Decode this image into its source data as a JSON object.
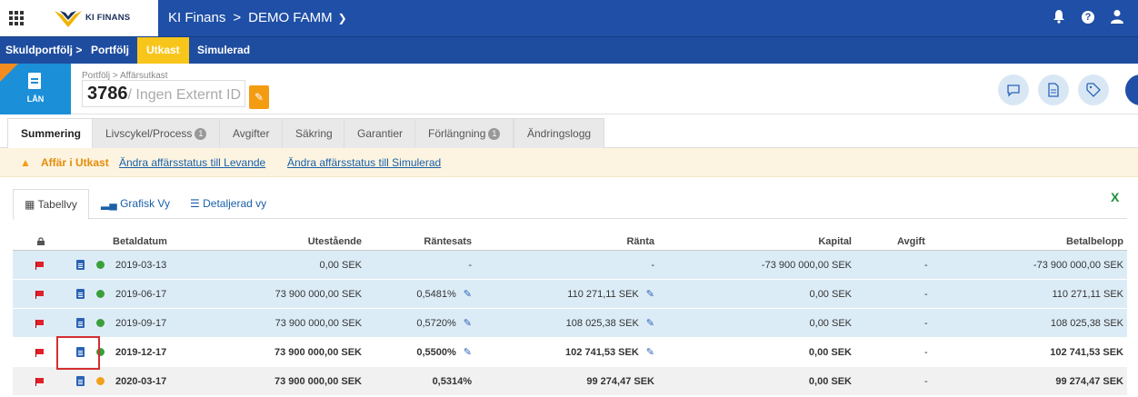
{
  "topbar": {
    "brand": "KI FINANS",
    "crumb_company": "KI Finans",
    "crumb_separator": ">",
    "crumb_client": "DEMO FAMM",
    "colors": {
      "primary": "#1f4fa6"
    }
  },
  "subnav": {
    "items": [
      {
        "label": "Skuldportfölj >"
      },
      {
        "label": "Portfölj"
      },
      {
        "label": "Utkast"
      },
      {
        "label": "Simulerad"
      }
    ],
    "active_color": "#f8c51a"
  },
  "header": {
    "type_label": "LÅN",
    "breadcrumb": "Portfölj > Affärsutkast",
    "id_number": "3786",
    "id_external": "/ Ingen Externt ID"
  },
  "tabs": [
    {
      "label": "Summering"
    },
    {
      "label": "Livscykel/Process",
      "badge": "1"
    },
    {
      "label": "Avgifter"
    },
    {
      "label": "Säkring"
    },
    {
      "label": "Garantier"
    },
    {
      "label": "Förlängning",
      "badge": "1"
    },
    {
      "label": "Ändringslogg"
    }
  ],
  "alert": {
    "text": "Affär i Utkast",
    "link1": "Ändra affärsstatus till Levande",
    "link2": "Ändra affärsstatus till Simulerad"
  },
  "views": [
    {
      "label": "Tabellvy"
    },
    {
      "label": "Grafisk Vy"
    },
    {
      "label": "Detaljerad vy"
    }
  ],
  "table": {
    "headers": {
      "betaldatum": "Betaldatum",
      "utestaende": "Utestående",
      "rantesats": "Räntesats",
      "ranta": "Ränta",
      "kapital": "Kapital",
      "avgift": "Avgift",
      "betalbelopp": "Betalbelopp"
    },
    "rows": [
      {
        "date": "2019-03-13",
        "utestaende": "0,00 SEK",
        "rantesats": "-",
        "ranta": "-",
        "kapital": "-73 900 000,00 SEK",
        "avgift": "-",
        "betalbelopp": "-73 900 000,00 SEK",
        "status": "green"
      },
      {
        "date": "2019-06-17",
        "utestaende": "73 900 000,00 SEK",
        "rantesats": "0,5481%",
        "ranta": "110 271,11 SEK",
        "kapital": "0,00 SEK",
        "avgift": "-",
        "betalbelopp": "110 271,11 SEK",
        "status": "green"
      },
      {
        "date": "2019-09-17",
        "utestaende": "73 900 000,00 SEK",
        "rantesats": "0,5720%",
        "ranta": "108 025,38 SEK",
        "kapital": "0,00 SEK",
        "avgift": "-",
        "betalbelopp": "108 025,38 SEK",
        "status": "green"
      },
      {
        "date": "2019-12-17",
        "utestaende": "73 900 000,00 SEK",
        "rantesats": "0,5500%",
        "ranta": "102 741,53 SEK",
        "kapital": "0,00 SEK",
        "avgift": "-",
        "betalbelopp": "102 741,53 SEK",
        "status": "green"
      },
      {
        "date": "2020-03-17",
        "utestaende": "73 900 000,00 SEK",
        "rantesats": "0,5314%",
        "ranta": "99 274,47 SEK",
        "kapital": "0,00 SEK",
        "avgift": "-",
        "betalbelopp": "99 274,47 SEK",
        "status": "orange"
      }
    ],
    "status_colors": {
      "green": "#3aa03a",
      "orange": "#f2a019"
    }
  }
}
